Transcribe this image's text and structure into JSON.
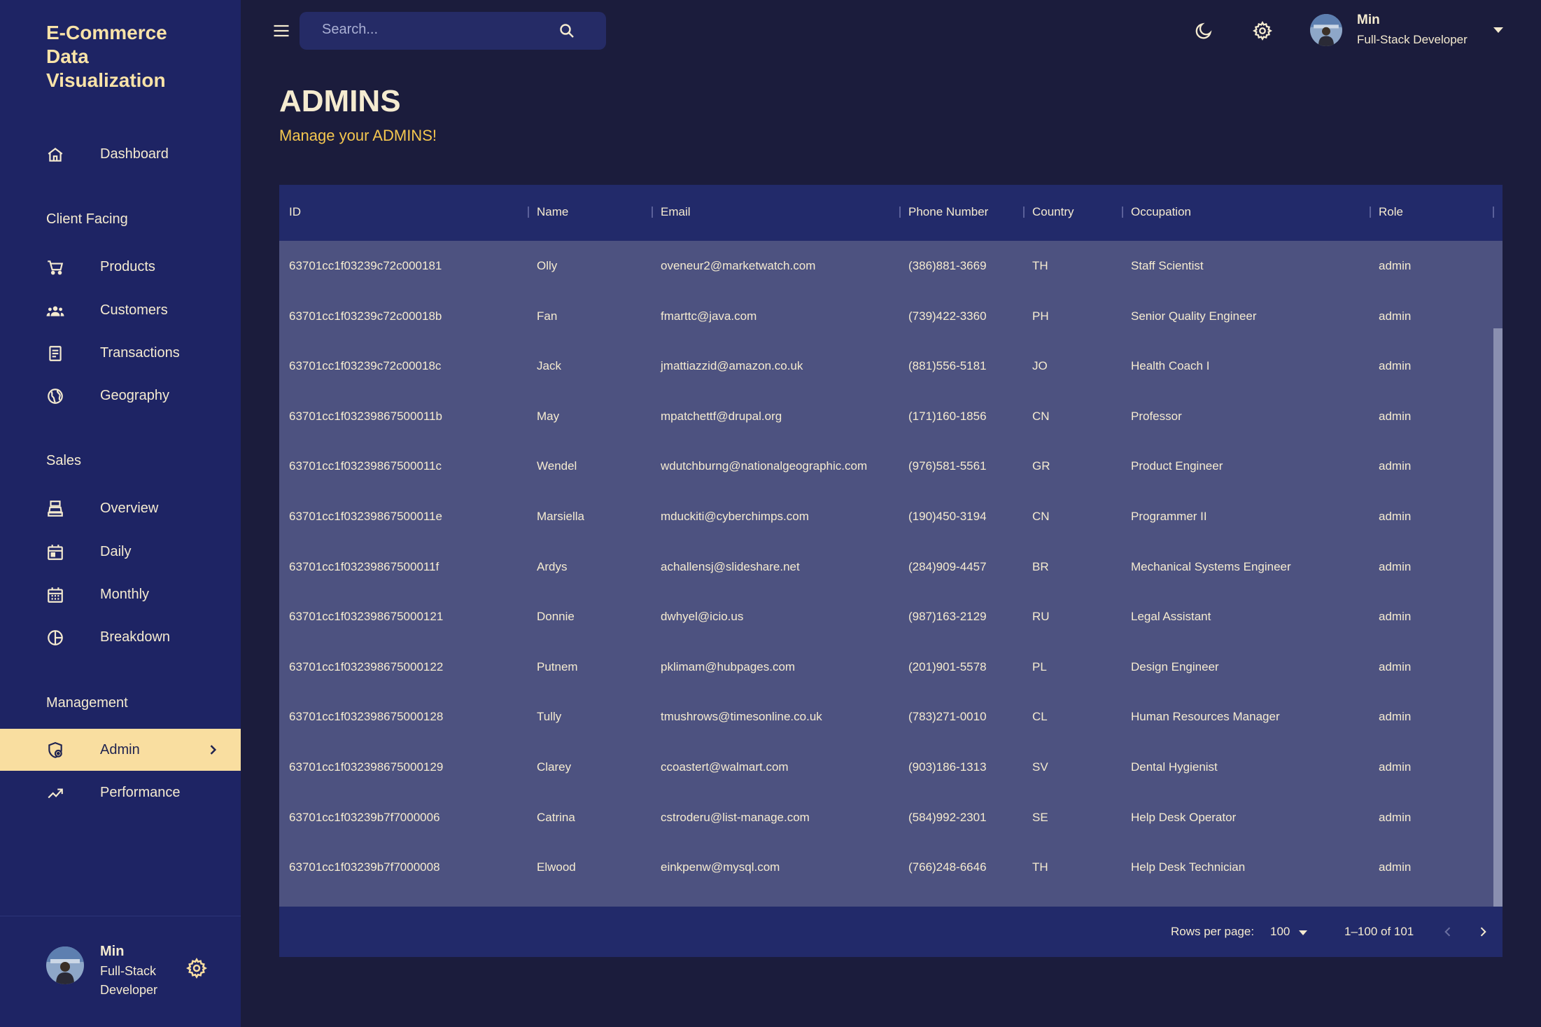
{
  "brand": {
    "line1": "E-Commerce",
    "line2": "Data",
    "line3": "Visualization"
  },
  "sidebar": {
    "dashboard": "Dashboard",
    "sections": {
      "client_facing": "Client Facing",
      "sales": "Sales",
      "management": "Management"
    },
    "client_items": [
      "Products",
      "Customers",
      "Transactions",
      "Geography"
    ],
    "sales_items": [
      "Overview",
      "Daily",
      "Monthly",
      "Breakdown"
    ],
    "management_items": [
      "Admin",
      "Performance"
    ],
    "active": "Admin",
    "user": {
      "name": "Min",
      "role": "Full-Stack Developer"
    }
  },
  "topbar": {
    "search_placeholder": "Search...",
    "user": {
      "name": "Min",
      "role": "Full-Stack Developer"
    }
  },
  "page": {
    "title": "ADMINS",
    "subtitle": "Manage your ADMINS!"
  },
  "table": {
    "columns": [
      "ID",
      "Name",
      "Email",
      "Phone Number",
      "Country",
      "Occupation",
      "Role"
    ],
    "rows": [
      [
        "63701cc1f03239c72c000181",
        "Olly",
        "oveneur2@marketwatch.com",
        "(386)881-3669",
        "TH",
        "Staff Scientist",
        "admin"
      ],
      [
        "63701cc1f03239c72c00018b",
        "Fan",
        "fmarttc@java.com",
        "(739)422-3360",
        "PH",
        "Senior Quality Engineer",
        "admin"
      ],
      [
        "63701cc1f03239c72c00018c",
        "Jack",
        "jmattiazzid@amazon.co.uk",
        "(881)556-5181",
        "JO",
        "Health Coach I",
        "admin"
      ],
      [
        "63701cc1f03239867500011b",
        "May",
        "mpatchettf@drupal.org",
        "(171)160-1856",
        "CN",
        "Professor",
        "admin"
      ],
      [
        "63701cc1f03239867500011c",
        "Wendel",
        "wdutchburng@nationalgeographic.com",
        "(976)581-5561",
        "GR",
        "Product Engineer",
        "admin"
      ],
      [
        "63701cc1f03239867500011e",
        "Marsiella",
        "mduckiti@cyberchimps.com",
        "(190)450-3194",
        "CN",
        "Programmer II",
        "admin"
      ],
      [
        "63701cc1f03239867500011f",
        "Ardys",
        "achallensj@slideshare.net",
        "(284)909-4457",
        "BR",
        "Mechanical Systems Engineer",
        "admin"
      ],
      [
        "63701cc1f032398675000121",
        "Donnie",
        "dwhyel@icio.us",
        "(987)163-2129",
        "RU",
        "Legal Assistant",
        "admin"
      ],
      [
        "63701cc1f032398675000122",
        "Putnem",
        "pklimam@hubpages.com",
        "(201)901-5578",
        "PL",
        "Design Engineer",
        "admin"
      ],
      [
        "63701cc1f032398675000128",
        "Tully",
        "tmushrows@timesonline.co.uk",
        "(783)271-0010",
        "CL",
        "Human Resources Manager",
        "admin"
      ],
      [
        "63701cc1f032398675000129",
        "Clarey",
        "ccoastert@walmart.com",
        "(903)186-1313",
        "SV",
        "Dental Hygienist",
        "admin"
      ],
      [
        "63701cc1f03239b7f7000006",
        "Catrina",
        "cstroderu@list-manage.com",
        "(584)992-2301",
        "SE",
        "Help Desk Operator",
        "admin"
      ],
      [
        "63701cc1f03239b7f7000008",
        "Elwood",
        "einkpenw@mysql.com",
        "(766)248-6646",
        "TH",
        "Help Desk Technician",
        "admin"
      ]
    ]
  },
  "pagination": {
    "rows_per_page_label": "Rows per page:",
    "rows_per_page": "100",
    "range": "1–100 of 101"
  }
}
